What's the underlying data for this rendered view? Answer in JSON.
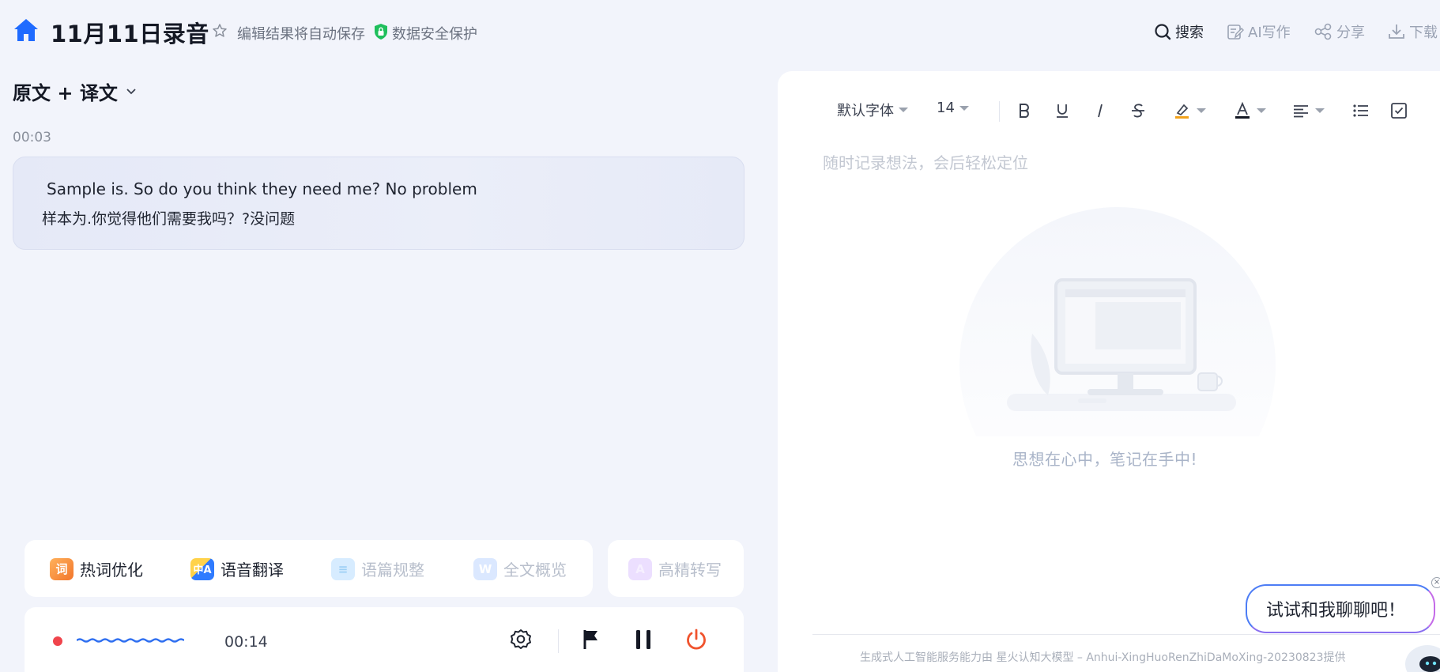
{
  "header": {
    "title": "11月11日录音",
    "autosave_text": "编辑结果将自动保存",
    "security_text": "数据安全保护",
    "actions": {
      "search": "搜索",
      "ai_write": "AI写作",
      "share": "分享",
      "download": "下载"
    }
  },
  "left": {
    "mode_label": "原文 + 译文",
    "segment": {
      "timestamp": "00:03",
      "original": "Sample is. So do you think they need me? No problem",
      "translation": "样本为.你觉得他们需要我吗？?没问题"
    },
    "features": [
      {
        "label": "热词优化",
        "icon_char": "词",
        "icon": "hotword-icon",
        "enabled": true
      },
      {
        "label": "语音翻译",
        "icon_char": "中A",
        "icon": "translate-icon",
        "enabled": true
      },
      {
        "label": "语篇规整",
        "icon_char": "≡",
        "icon": "paragraph-icon",
        "enabled": false
      },
      {
        "label": "全文概览",
        "icon_char": "W",
        "icon": "overview-icon",
        "enabled": false
      }
    ],
    "hq_feature": {
      "label": "高精转写",
      "icon_char": "A",
      "icon": "hq-transcribe-icon",
      "enabled": false
    },
    "player": {
      "elapsed": "00:14",
      "icons": [
        "record-dot-icon",
        "waveform-icon",
        "settings-icon",
        "flag-icon",
        "pause-icon",
        "power-icon"
      ]
    }
  },
  "notes": {
    "font_family": "默认字体",
    "font_size": "14",
    "placeholder": "随时记录想法，会后轻松定位",
    "empty_text": "思想在心中，笔记在手中!",
    "footer": "生成式人工智能服务能力由 星火认知大模型 – Anhui-XingHuoRenZhiDaMoXing-20230823提供",
    "toolbar_icons": [
      "bold-icon",
      "underline-icon",
      "italic-icon",
      "strikethrough-icon",
      "highlight-icon",
      "font-color-icon",
      "align-icon",
      "bullet-list-icon",
      "checkbox-icon"
    ]
  },
  "chat": {
    "bubble_text": "试试和我聊聊吧！",
    "close_char": "×"
  },
  "colors": {
    "brand_blue": "#1f6bff",
    "record_red": "#f0444c",
    "power_orange": "#f0532d",
    "secure_green": "#1fbf5c",
    "page_bg": "#f2f4fb"
  }
}
